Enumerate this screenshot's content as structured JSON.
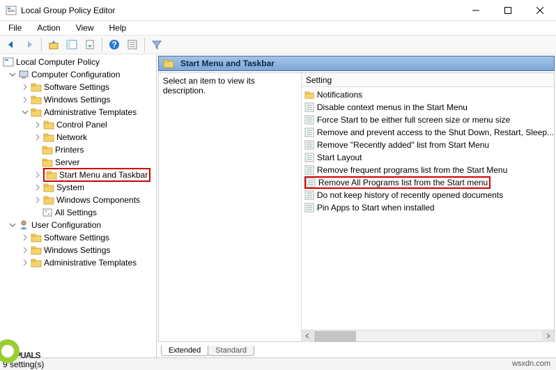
{
  "window": {
    "title": "Local Group Policy Editor"
  },
  "menu": {
    "file": "File",
    "action": "Action",
    "view": "View",
    "help": "Help"
  },
  "tree": {
    "root": "Local Computer Policy",
    "comp": "Computer Configuration",
    "sw": "Software Settings",
    "win": "Windows Settings",
    "admin": "Administrative Templates",
    "cp": "Control Panel",
    "net": "Network",
    "prn": "Printers",
    "srv": "Server",
    "start": "Start Menu and Taskbar",
    "sys": "System",
    "wincomp": "Windows Components",
    "allset": "All Settings",
    "user": "User Configuration",
    "usw": "Software Settings",
    "uwin": "Windows Settings",
    "uadmin": "Administrative Templates"
  },
  "right": {
    "header": "Start Menu and Taskbar",
    "desc": "Select an item to view its description.",
    "col": "Setting",
    "items": {
      "notif": "Notifications",
      "s1": "Disable context menus in the Start Menu",
      "s2": "Force Start to be either full screen size or menu size",
      "s3": "Remove and prevent access to the Shut Down, Restart, Sleep...",
      "s4": "Remove \"Recently added\" list from Start Menu",
      "s5": "Start Layout",
      "s6": "Remove frequent programs list from the Start Menu",
      "s7": "Remove All Programs list from the Start menu",
      "s8": "Do not keep history of recently opened documents",
      "s9": "Pin Apps to Start when installed"
    },
    "tabs": {
      "ext": "Extended",
      "std": "Standard"
    }
  },
  "status": "9 setting(s)",
  "watermark": {
    "logo": "PUALS",
    "url": "wsxdn.com"
  }
}
